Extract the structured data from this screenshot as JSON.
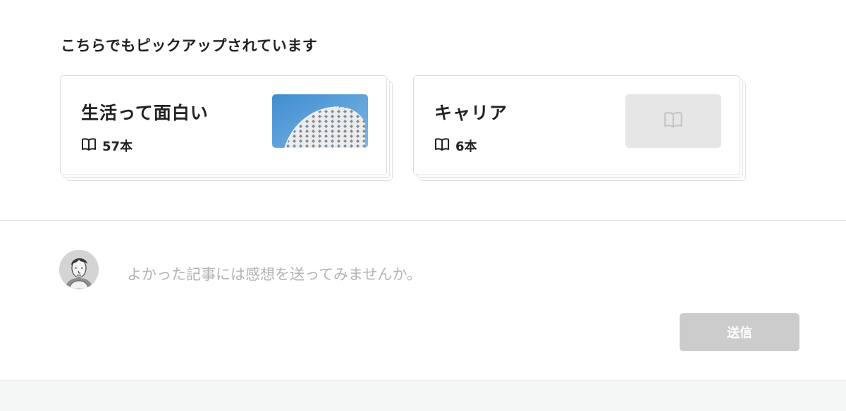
{
  "pickup": {
    "heading": "こちらでもピックアップされています",
    "cards": [
      {
        "title": "生活って面白い",
        "count": "57本",
        "thumbnail": "building-photo"
      },
      {
        "title": "キャリア",
        "count": "6本",
        "thumbnail": "book-icon"
      }
    ]
  },
  "comment": {
    "placeholder": "よかった記事には感想を送ってみませんか。",
    "send_label": "送信"
  },
  "colors": {
    "send_button_disabled": "#cccccc",
    "placeholder_thumb": "#e6e6e6",
    "sky_blue": "#4a9ad6"
  }
}
